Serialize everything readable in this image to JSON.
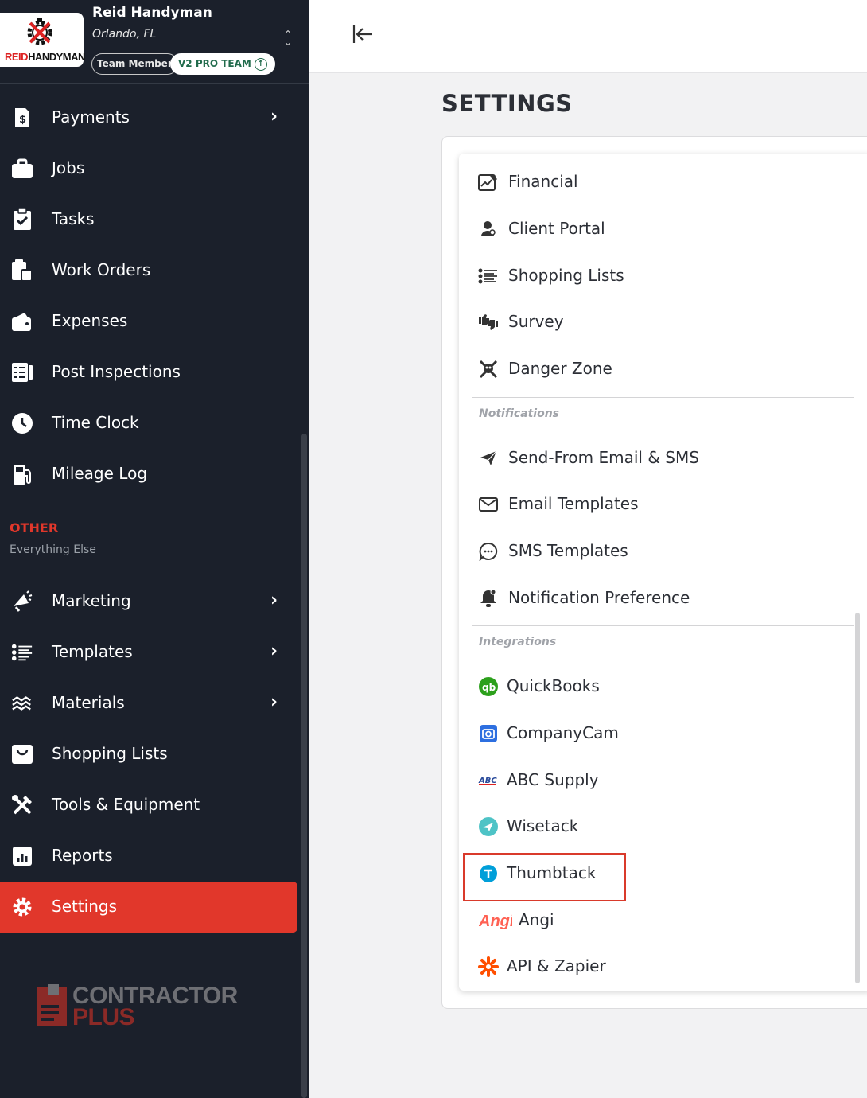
{
  "profile": {
    "business_name": "Reid Handyman",
    "location": "Orlando, FL",
    "logo_text_red": "REID",
    "logo_text_black": "HANDYMAN",
    "role_badge": "Team Member",
    "plan_badge": "V2 PRO TEAM"
  },
  "sidebar": {
    "items": [
      {
        "label": "Payments",
        "icon": "payments-icon",
        "has_chevron": true
      },
      {
        "label": "Jobs",
        "icon": "briefcase-icon"
      },
      {
        "label": "Tasks",
        "icon": "clipboard-check-icon"
      },
      {
        "label": "Work Orders",
        "icon": "work-orders-icon"
      },
      {
        "label": "Expenses",
        "icon": "wallet-icon"
      },
      {
        "label": "Post Inspections",
        "icon": "checklist-icon"
      },
      {
        "label": "Time Clock",
        "icon": "clock-icon"
      },
      {
        "label": "Mileage Log",
        "icon": "fuel-icon"
      }
    ],
    "other_title": "OTHER",
    "other_subtitle": "Everything Else",
    "other_items": [
      {
        "label": "Marketing",
        "icon": "megaphone-icon",
        "has_chevron": true
      },
      {
        "label": "Templates",
        "icon": "list-icon",
        "has_chevron": true
      },
      {
        "label": "Materials",
        "icon": "materials-icon",
        "has_chevron": true
      },
      {
        "label": "Shopping Lists",
        "icon": "bag-icon"
      },
      {
        "label": "Tools & Equipment",
        "icon": "tools-icon"
      },
      {
        "label": "Reports",
        "icon": "reports-icon"
      },
      {
        "label": "Settings",
        "icon": "gear-icon",
        "active": true
      }
    ],
    "brand_line1": "CONTRACTOR",
    "brand_line2": "PLUS"
  },
  "page": {
    "title": "SETTINGS"
  },
  "settings_menu": {
    "general": [
      {
        "label": "Financial",
        "icon": "financial-icon"
      },
      {
        "label": "Client Portal",
        "icon": "user-icon"
      },
      {
        "label": "Shopping Lists",
        "icon": "list-icon"
      },
      {
        "label": "Survey",
        "icon": "thumbs-icon"
      },
      {
        "label": "Danger Zone",
        "icon": "skull-icon"
      }
    ],
    "notifications_title": "Notifications",
    "notifications": [
      {
        "label": "Send-From Email & SMS",
        "icon": "send-icon"
      },
      {
        "label": "Email Templates",
        "icon": "envelope-icon"
      },
      {
        "label": "SMS Templates",
        "icon": "chat-icon"
      },
      {
        "label": "Notification Preference",
        "icon": "bell-icon"
      }
    ],
    "integrations_title": "Integrations",
    "integrations": [
      {
        "label": "QuickBooks",
        "icon": "quickbooks-icon"
      },
      {
        "label": "CompanyCam",
        "icon": "companycam-icon"
      },
      {
        "label": "ABC Supply",
        "icon": "abc-supply-icon",
        "icon_text": "ABC"
      },
      {
        "label": "Wisetack",
        "icon": "wisetack-icon"
      },
      {
        "label": "Thumbtack",
        "icon": "thumbtack-icon",
        "highlighted": true
      },
      {
        "label": "Angi",
        "icon": "angi-icon",
        "icon_text": "Angi"
      },
      {
        "label": "API & Zapier",
        "icon": "zapier-icon"
      }
    ]
  },
  "colors": {
    "sidebar_bg": "#1b202b",
    "accent_red": "#e1372b",
    "pro_green": "#216b4c",
    "quickbooks_green": "#2ca01c",
    "thumbtack_blue": "#009fd9",
    "angi_red": "#ff6153",
    "zapier_orange": "#ff4f00"
  }
}
